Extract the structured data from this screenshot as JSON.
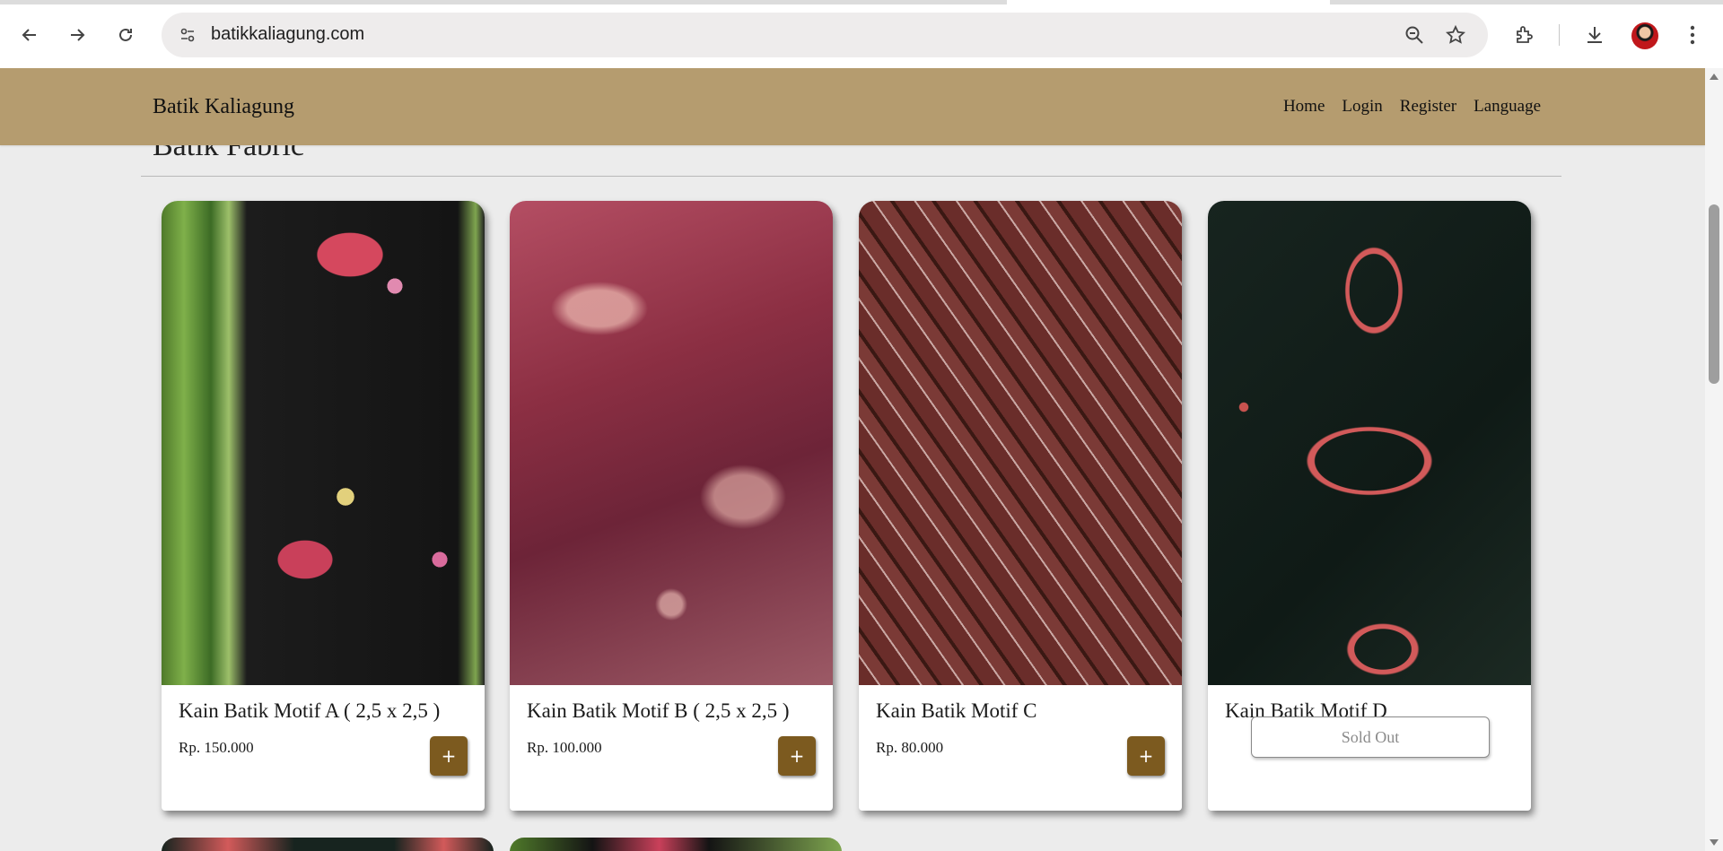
{
  "browser": {
    "url": "batikkaliagung.com"
  },
  "navbar": {
    "brand": "Batik Kaliagung",
    "links": [
      "Home",
      "Login",
      "Register",
      "Language"
    ]
  },
  "section": {
    "title": "Batik Fabric"
  },
  "products": [
    {
      "name": "Kain Batik Motif A ( 2,5 x 2,5 )",
      "price": "Rp. 150.000",
      "action": "+"
    },
    {
      "name": "Kain Batik Motif B ( 2,5 x 2,5 )",
      "price": "Rp. 100.000",
      "action": "+"
    },
    {
      "name": "Kain Batik Motif C",
      "price": "Rp. 80.000",
      "action": "+"
    },
    {
      "name": "Kain Batik Motif D",
      "status": "Sold Out"
    }
  ],
  "colors": {
    "navbar_bg": "#b59c6f",
    "add_button": "#7c5a1f",
    "page_bg": "#ececec"
  }
}
